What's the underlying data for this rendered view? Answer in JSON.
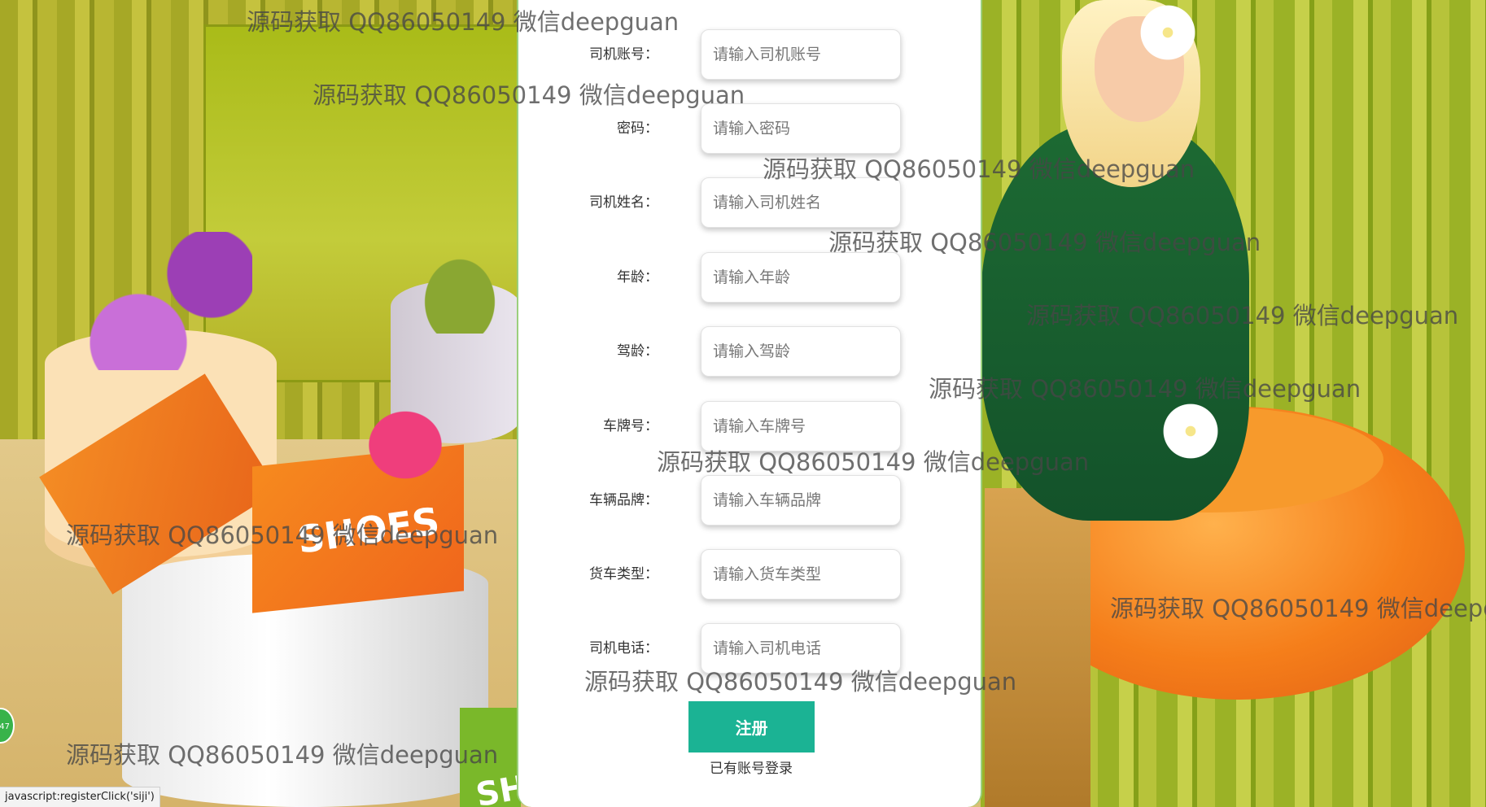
{
  "form": {
    "fields": [
      {
        "label": "司机账号：",
        "placeholder": "请输入司机账号",
        "type": "text"
      },
      {
        "label": "密码：",
        "placeholder": "请输入密码",
        "type": "password"
      },
      {
        "label": "司机姓名：",
        "placeholder": "请输入司机姓名",
        "type": "text"
      },
      {
        "label": "年龄：",
        "placeholder": "请输入年龄",
        "type": "text"
      },
      {
        "label": "驾龄：",
        "placeholder": "请输入驾龄",
        "type": "text"
      },
      {
        "label": "车牌号：",
        "placeholder": "请输入车牌号",
        "type": "text"
      },
      {
        "label": "车辆品牌：",
        "placeholder": "请输入车辆品牌",
        "type": "text"
      },
      {
        "label": "货车类型：",
        "placeholder": "请输入货车类型",
        "type": "text"
      },
      {
        "label": "司机电话：",
        "placeholder": "请输入司机电话",
        "type": "text"
      }
    ],
    "register_label": "注册",
    "login_link": "已有账号登录"
  },
  "watermark_text": "源码获取 QQ86050149 微信deepguan",
  "status_bar": "javascript:registerClick('siji')",
  "side_badge": "47",
  "background": {
    "box_text": "SHOES",
    "box_text_partial": "SH"
  },
  "colors": {
    "register_button": "#1bb394",
    "card_border": "#9bcf7d"
  }
}
